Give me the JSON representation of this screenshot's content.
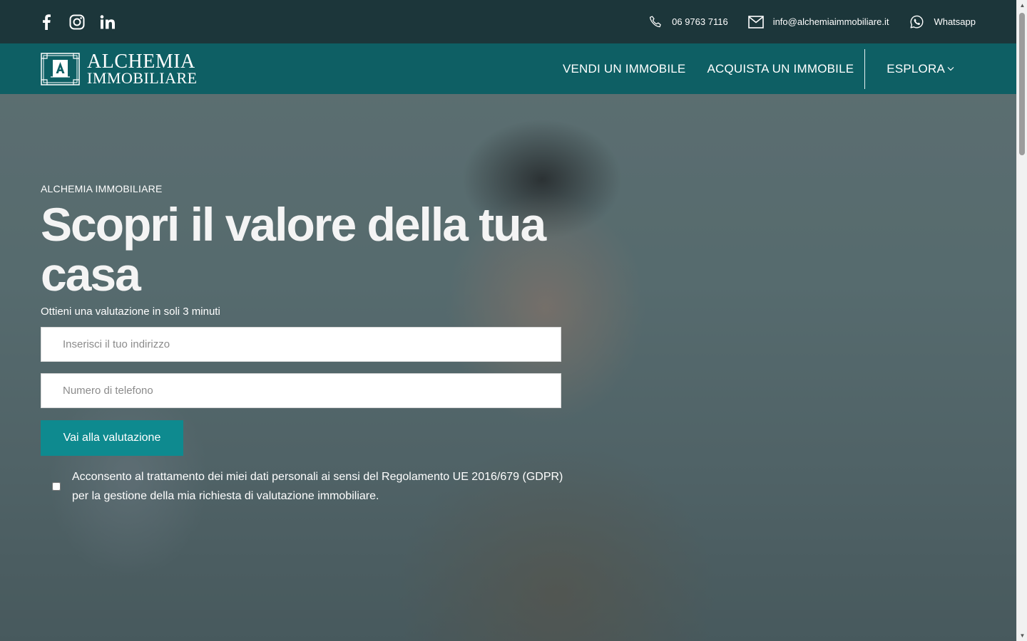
{
  "topbar": {
    "social": [
      "facebook-icon",
      "instagram-icon",
      "linkedin-icon"
    ],
    "phone": "06 9763 7116",
    "email": "info@alchemiaimmobiliare.it",
    "whatsapp": "Whatsapp"
  },
  "nav": {
    "logo_line1": "ALCHEMIA",
    "logo_line2": "IMMOBILIARE",
    "items": [
      "VENDI UN IMMOBILE",
      "ACQUISTA UN IMMOBILE"
    ],
    "explore": "ESPLORA"
  },
  "hero": {
    "eyebrow": "ALCHEMIA IMMOBILIARE",
    "title": "Scopri il valore della tua casa",
    "subtitle": "Ottieni una valutazione in soli 3 minuti",
    "address_placeholder": "Inserisci il tuo indirizzo",
    "phone_placeholder": "Numero di telefono",
    "cta": "Vai alla valutazione",
    "consent": "Acconsento al trattamento dei miei dati personali ai sensi del Regolamento UE 2016/679 (GDPR) per la gestione della mia richiesta di valutazione immobiliare."
  },
  "colors": {
    "topbar_bg": "#1c363a",
    "nav_bg": "#0e5f64",
    "cta_bg": "#0e8a8f"
  }
}
